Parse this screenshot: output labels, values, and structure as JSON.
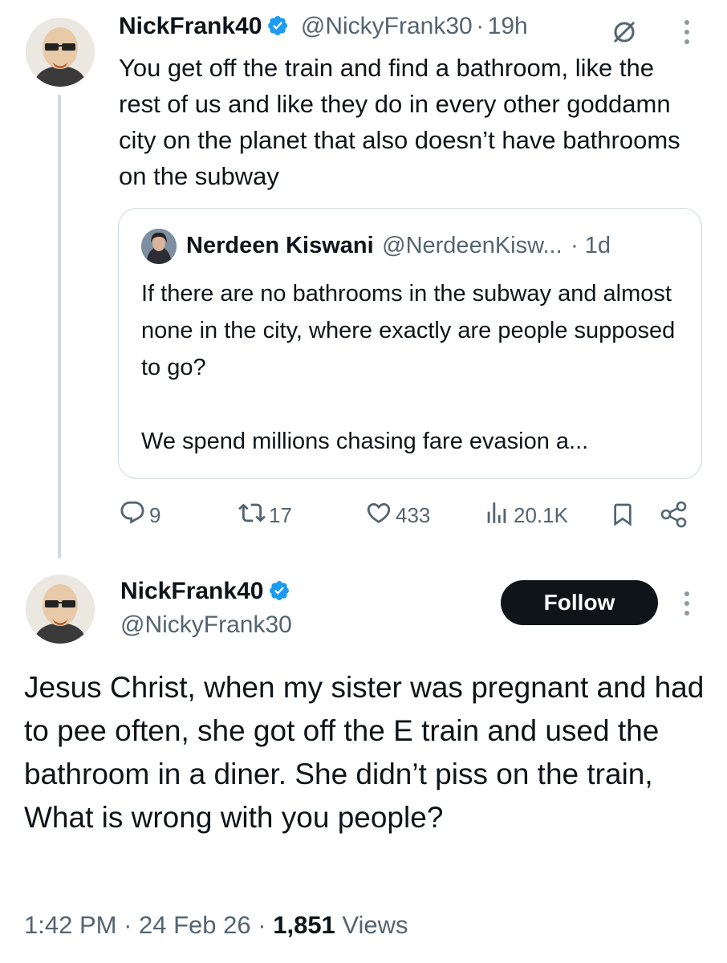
{
  "parent_tweet": {
    "author_name": "NickFrank40",
    "handle": "@NickyFrank30",
    "separator": "·",
    "time": "19h",
    "text": "You get off the train and find a bathroom, like the rest of us and like they do in every other goddamn city on the planet that also doesn’t have bathrooms on the subway",
    "quote": {
      "author_name": "Nerdeen Kiswani",
      "handle": "@NerdeenKisw...",
      "time": "· 1d",
      "text_p1": "If there are no bathrooms in the subway and almost none in the city, where exactly are people supposed to go?",
      "text_p2": "We spend millions chasing fare evasion a..."
    },
    "actions": {
      "replies": "9",
      "reposts": "17",
      "likes": "433",
      "views": "20.1K"
    }
  },
  "main_tweet": {
    "author_name": "NickFrank40",
    "handle": "@NickyFrank30",
    "follow_label": "Follow",
    "text_lines": [
      "Jesus Christ, when my sister was pregnant and had to pee often, she got off the E train and used the bathroom in a diner. She didn’t piss on the train,",
      "What is wrong with you people?"
    ],
    "time": "1:42 PM",
    "date": "24 Feb 26",
    "views_count": "1,851",
    "views_label": "Views",
    "meta_separator": "·"
  },
  "colors": {
    "text": "#0f1419",
    "secondary": "#536471",
    "verified": "#1d9bf0",
    "border": "#cfd9de"
  },
  "icons": [
    "verified-badge-icon",
    "grok-icon",
    "more-icon",
    "reply-icon",
    "repost-icon",
    "like-icon",
    "views-icon",
    "bookmark-icon",
    "share-icon"
  ]
}
